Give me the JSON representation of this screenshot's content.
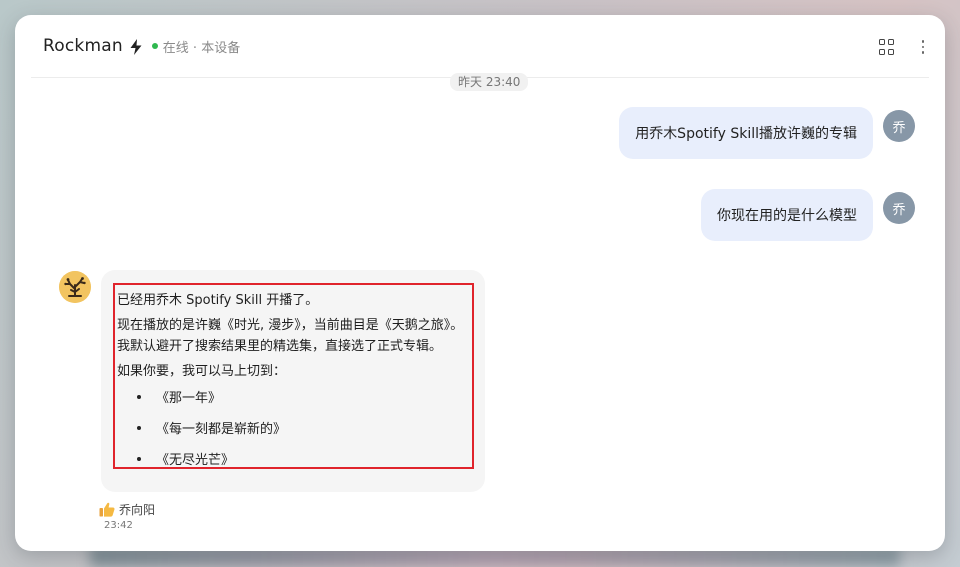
{
  "header": {
    "title": "Rockman",
    "status": "在线 · 本设备",
    "status_color": "#2fb84f"
  },
  "timestamp_divider": "昨天 23:40",
  "messages_user": [
    {
      "text": "用乔木Spotify Skill播放许巍的专辑",
      "avatar": "乔"
    },
    {
      "text": "你现在用的是什么模型",
      "avatar": "乔"
    }
  ],
  "bot_message": {
    "lines": [
      "已经用乔木 Spotify Skill 开播了。",
      "现在播放的是许巍《时光, 漫步》，当前曲目是《天鹅之旅》。",
      "我默认避开了搜索结果里的精选集，直接选了正式专辑。",
      "如果你要，我可以马上切到："
    ],
    "options": [
      "《那一年》",
      "《每一刻都是崭新的》",
      "《无尽光芒》"
    ],
    "reaction_name": "乔向阳",
    "reaction_icon": "thumbs-up-icon",
    "time": "23:42"
  },
  "colors": {
    "highlight_border": "#e0242c",
    "user_bubble": "#e8eefc",
    "bot_bubble": "#f5f5f5"
  }
}
